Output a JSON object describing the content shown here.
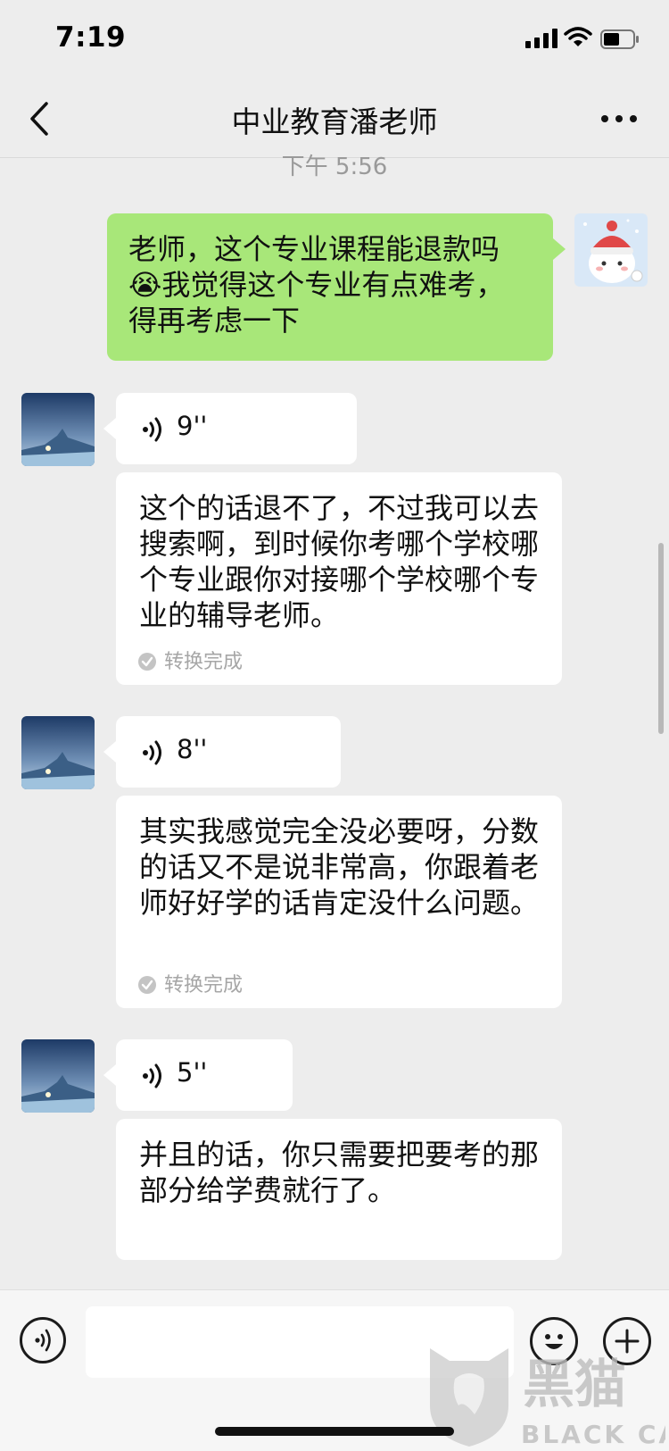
{
  "status_bar": {
    "time": "7:19"
  },
  "nav": {
    "title": "中业教育潘老师"
  },
  "chat": {
    "timestamp": "下午 5:56",
    "my_message": "老师，这个专业课程能退款吗😭我觉得这个专业有点难考，得再考虑一下",
    "voice_messages": [
      {
        "duration": "9''",
        "transcript": "这个的话退不了，不过我可以去搜索啊，到时候你考哪个学校哪个专业跟你对接哪个学校哪个专业的辅导老师。",
        "status": "转换完成"
      },
      {
        "duration": "8''",
        "transcript": "其实我感觉完全没必要呀，分数的话又不是说非常高，你跟着老师好好学的话肯定没什么问题。",
        "status": "转换完成"
      },
      {
        "duration": "5''",
        "transcript": "并且的话，你只需要把要考的那部分给学费就行了。"
      }
    ]
  },
  "input_bar": {
    "value": ""
  },
  "watermark": {
    "brand_cn": "黑猫",
    "brand_en": "BLACK CAT"
  },
  "colors": {
    "my_bubble": "#a8e779",
    "their_bubble": "#ffffff",
    "background": "#ededed"
  },
  "icons": {
    "back": "chevron-left-icon",
    "more": "more-dots-icon",
    "voice": "voice-wave-icon",
    "emoji": "smiley-icon",
    "plus": "plus-icon",
    "check": "check-circle-icon"
  }
}
